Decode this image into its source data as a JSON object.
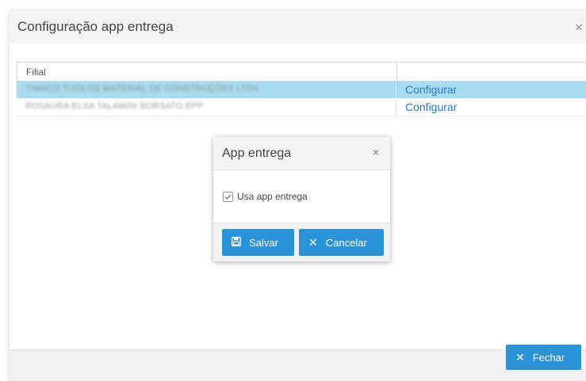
{
  "outer_dialog": {
    "title": "Configuração app entrega",
    "close_glyph": "×",
    "table": {
      "columns": [
        "Filial",
        ""
      ],
      "rows": [
        {
          "name": "TIMACO TIJOLOS MATERIAL DE CONSTRUÇÕES LTDA",
          "action": "Configurar",
          "selected": true
        },
        {
          "name": "ROSAURA ELSA TALAMINI BORSATO EPP",
          "action": "Configurar",
          "selected": false
        }
      ]
    },
    "footer": {
      "close_label": "Fechar",
      "close_icon": "times-icon"
    }
  },
  "inner_dialog": {
    "title": "App entrega",
    "close_glyph": "×",
    "checkbox_label": "Usa app entrega",
    "checkbox_checked": true,
    "save_label": "Salvar",
    "cancel_label": "Cancelar",
    "save_icon": "save-icon",
    "cancel_icon": "times-icon"
  },
  "colors": {
    "primary": "#2b93d6",
    "selected_row": "#a9dcf1",
    "link": "#2a7bbf",
    "header_bg": "#f4f4f4"
  }
}
